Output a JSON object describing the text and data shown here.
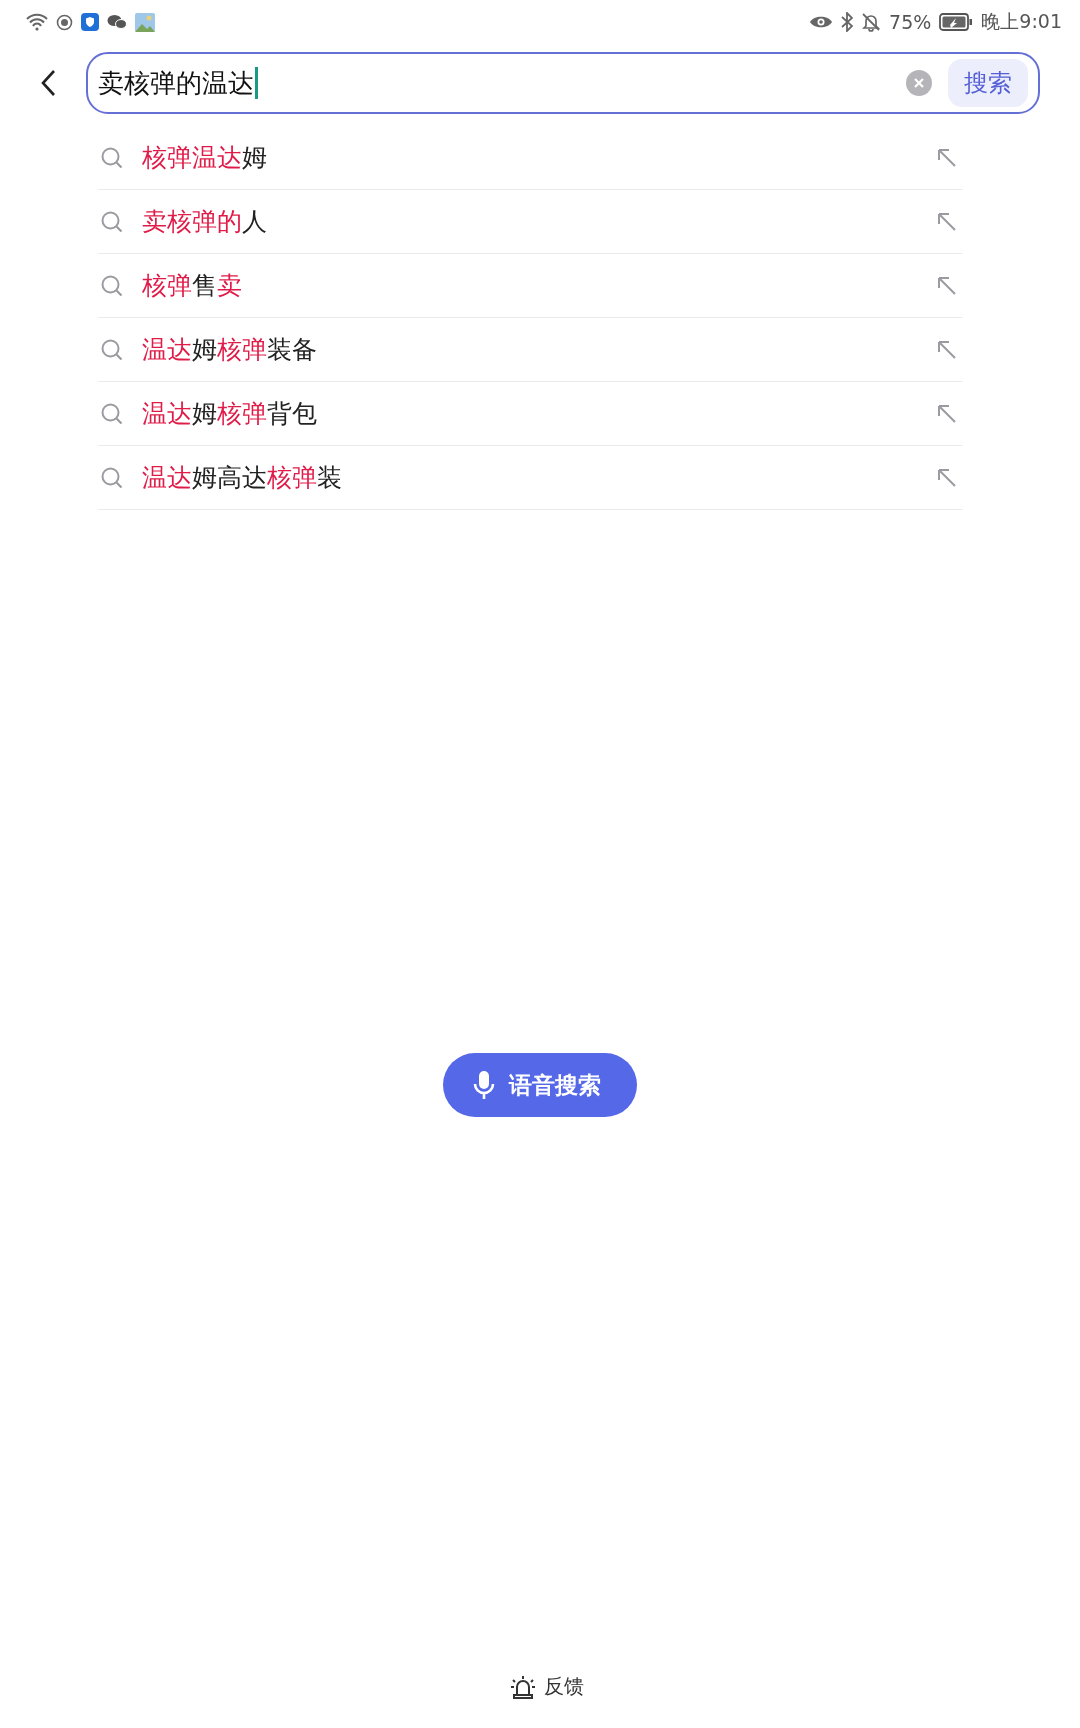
{
  "status_bar": {
    "battery_percent": "75%",
    "time": "晚上9:01"
  },
  "search": {
    "value": "卖核弹的温达",
    "button": "搜索"
  },
  "suggestions": [
    {
      "segments": [
        {
          "text": "核弹温达",
          "highlight": true
        },
        {
          "text": "姆",
          "highlight": false
        }
      ]
    },
    {
      "segments": [
        {
          "text": "卖核弹的",
          "highlight": true
        },
        {
          "text": "人",
          "highlight": false
        }
      ]
    },
    {
      "segments": [
        {
          "text": "核弹",
          "highlight": true
        },
        {
          "text": "售",
          "highlight": false
        },
        {
          "text": "卖",
          "highlight": true
        }
      ]
    },
    {
      "segments": [
        {
          "text": "温达",
          "highlight": true
        },
        {
          "text": "姆",
          "highlight": false
        },
        {
          "text": "核弹",
          "highlight": true
        },
        {
          "text": "装备",
          "highlight": false
        }
      ]
    },
    {
      "segments": [
        {
          "text": "温达",
          "highlight": true
        },
        {
          "text": "姆",
          "highlight": false
        },
        {
          "text": "核弹",
          "highlight": true
        },
        {
          "text": "背包",
          "highlight": false
        }
      ]
    },
    {
      "segments": [
        {
          "text": "温达",
          "highlight": true
        },
        {
          "text": "姆高达",
          "highlight": false
        },
        {
          "text": "核弹",
          "highlight": true
        },
        {
          "text": "装",
          "highlight": false
        }
      ]
    }
  ],
  "voice_button": "语音搜索",
  "feedback": "反馈"
}
